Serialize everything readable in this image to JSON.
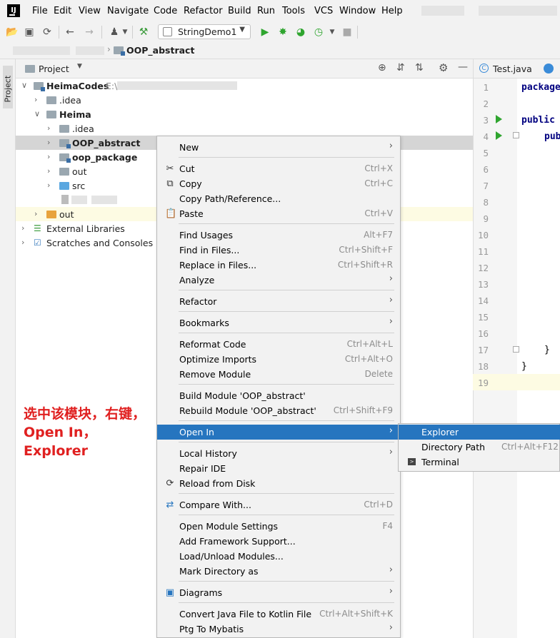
{
  "menubar": {
    "items": [
      "File",
      "Edit",
      "View",
      "Navigate",
      "Code",
      "Refactor",
      "Build",
      "Run",
      "Tools",
      "VCS",
      "Window",
      "Help"
    ]
  },
  "toolbar": {
    "run_config": "StringDemo1"
  },
  "breadcrumb": {
    "current": "OOP_abstract"
  },
  "side_strip": {
    "label": "Project"
  },
  "project_panel": {
    "title": "Project"
  },
  "tree": {
    "root": "HeimaCodes",
    "root_path": "E:\\",
    "idea_top": ".idea",
    "heima": "Heima",
    "idea_inner": ".idea",
    "oop_abstract": "OOP_abstract",
    "oop_package": "oop_package",
    "out_inner": "out",
    "src": "src",
    "out_top": "out",
    "external_libraries": "External Libraries",
    "scratches": "Scratches and Consoles"
  },
  "editor": {
    "tab": "Test.java",
    "line_numbers": [
      "1",
      "2",
      "3",
      "4",
      "5",
      "6",
      "7",
      "8",
      "9",
      "10",
      "11",
      "12",
      "13",
      "14",
      "15",
      "16",
      "17",
      "18",
      "19"
    ],
    "code": {
      "l1": "package",
      "l3": "public",
      "l4": "pub",
      "l17": "}",
      "l18": "}"
    }
  },
  "context_menu": {
    "items": [
      {
        "label": "New",
        "shortcut": "",
        "submenu": true
      },
      {
        "label": "Cut",
        "shortcut": "Ctrl+X",
        "icon": "cut-icon"
      },
      {
        "label": "Copy",
        "shortcut": "Ctrl+C",
        "icon": "copy-icon"
      },
      {
        "label": "Copy Path/Reference...",
        "shortcut": ""
      },
      {
        "label": "Paste",
        "shortcut": "Ctrl+V",
        "icon": "paste-icon"
      },
      {
        "label": "Find Usages",
        "shortcut": "Alt+F7"
      },
      {
        "label": "Find in Files...",
        "shortcut": "Ctrl+Shift+F"
      },
      {
        "label": "Replace in Files...",
        "shortcut": "Ctrl+Shift+R"
      },
      {
        "label": "Analyze",
        "shortcut": "",
        "submenu": true
      },
      {
        "label": "Refactor",
        "shortcut": "",
        "submenu": true
      },
      {
        "label": "Bookmarks",
        "shortcut": "",
        "submenu": true
      },
      {
        "label": "Reformat Code",
        "shortcut": "Ctrl+Alt+L"
      },
      {
        "label": "Optimize Imports",
        "shortcut": "Ctrl+Alt+O"
      },
      {
        "label": "Remove Module",
        "shortcut": "Delete"
      },
      {
        "label": "Build Module 'OOP_abstract'",
        "shortcut": ""
      },
      {
        "label": "Rebuild Module 'OOP_abstract'",
        "shortcut": "Ctrl+Shift+F9"
      },
      {
        "label": "Open In",
        "shortcut": "",
        "submenu": true,
        "highlighted": true
      },
      {
        "label": "Local History",
        "shortcut": "",
        "submenu": true
      },
      {
        "label": "Repair IDE",
        "shortcut": ""
      },
      {
        "label": "Reload from Disk",
        "shortcut": "",
        "icon": "reload-icon"
      },
      {
        "label": "Compare With...",
        "shortcut": "Ctrl+D",
        "icon": "compare-icon"
      },
      {
        "label": "Open Module Settings",
        "shortcut": "F4"
      },
      {
        "label": "Add Framework Support...",
        "shortcut": ""
      },
      {
        "label": "Load/Unload Modules...",
        "shortcut": ""
      },
      {
        "label": "Mark Directory as",
        "shortcut": "",
        "submenu": true
      },
      {
        "label": "Diagrams",
        "shortcut": "",
        "submenu": true,
        "icon": "diagram-icon"
      },
      {
        "label": "Convert Java File to Kotlin File",
        "shortcut": "Ctrl+Alt+Shift+K"
      },
      {
        "label": "Ptg To Mybatis",
        "shortcut": "",
        "submenu": true
      }
    ]
  },
  "submenu": {
    "items": [
      {
        "label": "Explorer",
        "shortcut": "",
        "highlighted": true
      },
      {
        "label": "Directory Path",
        "shortcut": "Ctrl+Alt+F12"
      },
      {
        "label": "Terminal",
        "shortcut": "",
        "icon": "terminal-icon"
      }
    ]
  },
  "annotation": {
    "line1": "选中该模块，右键，",
    "line2": "Open In，",
    "line3": "Explorer"
  },
  "colors": {
    "highlight": "#2675bf",
    "annotation": "#e02020",
    "selected_row": "#d5d5d5"
  }
}
